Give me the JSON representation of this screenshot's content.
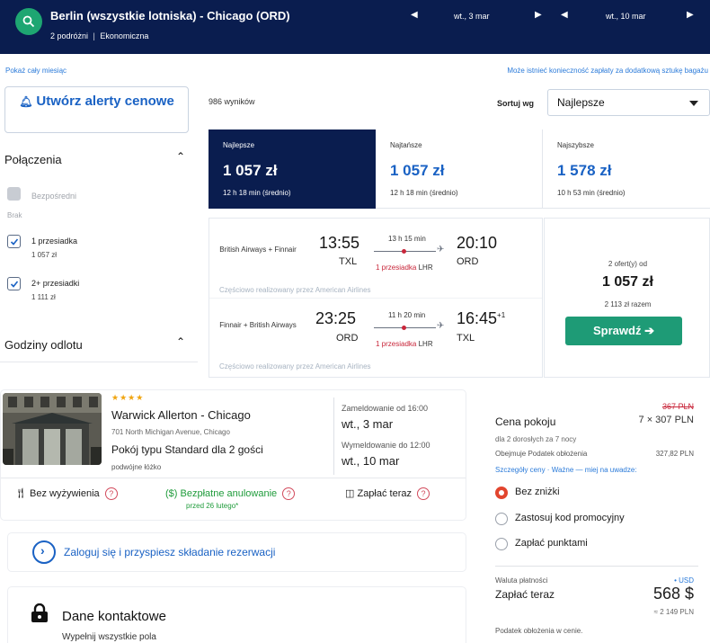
{
  "search": {
    "route": "Berlin (wszystkie lotniska) - Chicago (ORD)",
    "passengers": "2 podróżni",
    "cabin": "Ekonomiczna",
    "depart_date": "wt., 3 mar",
    "return_date": "wt., 10 mar"
  },
  "links": {
    "whole_month": "Pokaż cały miesiąc",
    "bag_fee": "Może istnieć konieczność zapłaty za dodatkową sztukę bagażu"
  },
  "filters": {
    "alert_button": "Utwórz alerty cenowe",
    "connections_title": "Połączenia",
    "items": [
      {
        "label": "Bezpośredni",
        "sub": "Brak",
        "checked": false,
        "disabled": true
      },
      {
        "label": "1 przesiadka",
        "sub": "1 057 zł",
        "checked": true,
        "disabled": false
      },
      {
        "label": "2+ przesiadki",
        "sub": "1 111 zł",
        "checked": true,
        "disabled": false
      }
    ],
    "departure_title": "Godziny odlotu"
  },
  "results": {
    "count": "986 wyników",
    "sort_label": "Sortuj wg",
    "sort_value": "Najlepsze",
    "tabs": [
      {
        "name": "Najlepsze",
        "price": "1 057 zł",
        "duration": "12 h 18 min (średnio)"
      },
      {
        "name": "Najtańsze",
        "price": "1 057 zł",
        "duration": "12 h 18 min (średnio)"
      },
      {
        "name": "Najszybsze",
        "price": "1 578 zł",
        "duration": "10 h 53 min (średnio)"
      }
    ]
  },
  "flight": {
    "legs": [
      {
        "airline": "British Airways + Finnair",
        "dep_time": "13:55",
        "dep_ap": "TXL",
        "duration": "13 h 15 min",
        "arr_time": "20:10",
        "arr_ap": "ORD",
        "arr_plus": "",
        "stops": "1 przesiadka",
        "via": "LHR"
      },
      {
        "airline": "Finnair + British Airways",
        "dep_time": "23:25",
        "dep_ap": "ORD",
        "duration": "11 h 20 min",
        "arr_time": "16:45",
        "arr_ap": "TXL",
        "arr_plus": "+1",
        "stops": "1 przesiadka",
        "via": "LHR"
      }
    ],
    "operated_by": "Częściowo realizowany przez American Airlines",
    "offers": "2 ofert(y) od",
    "price": "1 057 zł",
    "total": "2 113 zł razem",
    "check_button": "Sprawdź"
  },
  "hotel": {
    "stars": "★★★★",
    "name": "Warwick Allerton - Chicago",
    "address": "701 North Michigan Avenue, Chicago",
    "room": "Pokój typu Standard dla 2 gości",
    "bed": "podwójne łóżko",
    "checkin_label": "Zameldowanie od 16:00",
    "checkin_date": "wt., 3 mar",
    "checkout_label": "Wymeldowanie do 12:00",
    "checkout_date": "wt., 10 mar",
    "amenities": {
      "meals": "Bez wyżywienia",
      "cancel": "Bezpłatne anulowanie",
      "cancel_sub": "przed 26 lutego*",
      "pay": "Zapłać teraz"
    },
    "login": "Zaloguj się i przyspiesz składanie rezerwacji",
    "contact_title": "Dane kontaktowe",
    "contact_sub": "Wypełnij wszystkie pola"
  },
  "price_panel": {
    "old_price": "367 PLN",
    "room_price_label": "Cena pokoju",
    "room_price": "7 × 307 PLN",
    "guests": "dla 2 dorosłych  za 7 nocy",
    "tax_label": "Obejmuje Podatek obłożenia",
    "tax_value": "327,82 PLN",
    "details_link": "Szczegóły ceny  ·  Ważne — miej na uwadze:",
    "options": [
      "Bez zniżki",
      "Zastosuj kod promocyjny",
      "Zapłać punktami"
    ],
    "currency_label": "Waluta płatności",
    "currency_value": "• USD",
    "pay_now_label": "Zapłać teraz",
    "pay_now_value": "568 $",
    "approx": "≈ 2 149 PLN",
    "tax_included": "Podatek obłożenia w cenie."
  },
  "colors": {
    "navy": "#0a1d4f",
    "accent_blue": "#1a62c4",
    "green_button": "#1e9b76",
    "stop_red": "#c8263a",
    "radio_selected": "#e2452e"
  }
}
